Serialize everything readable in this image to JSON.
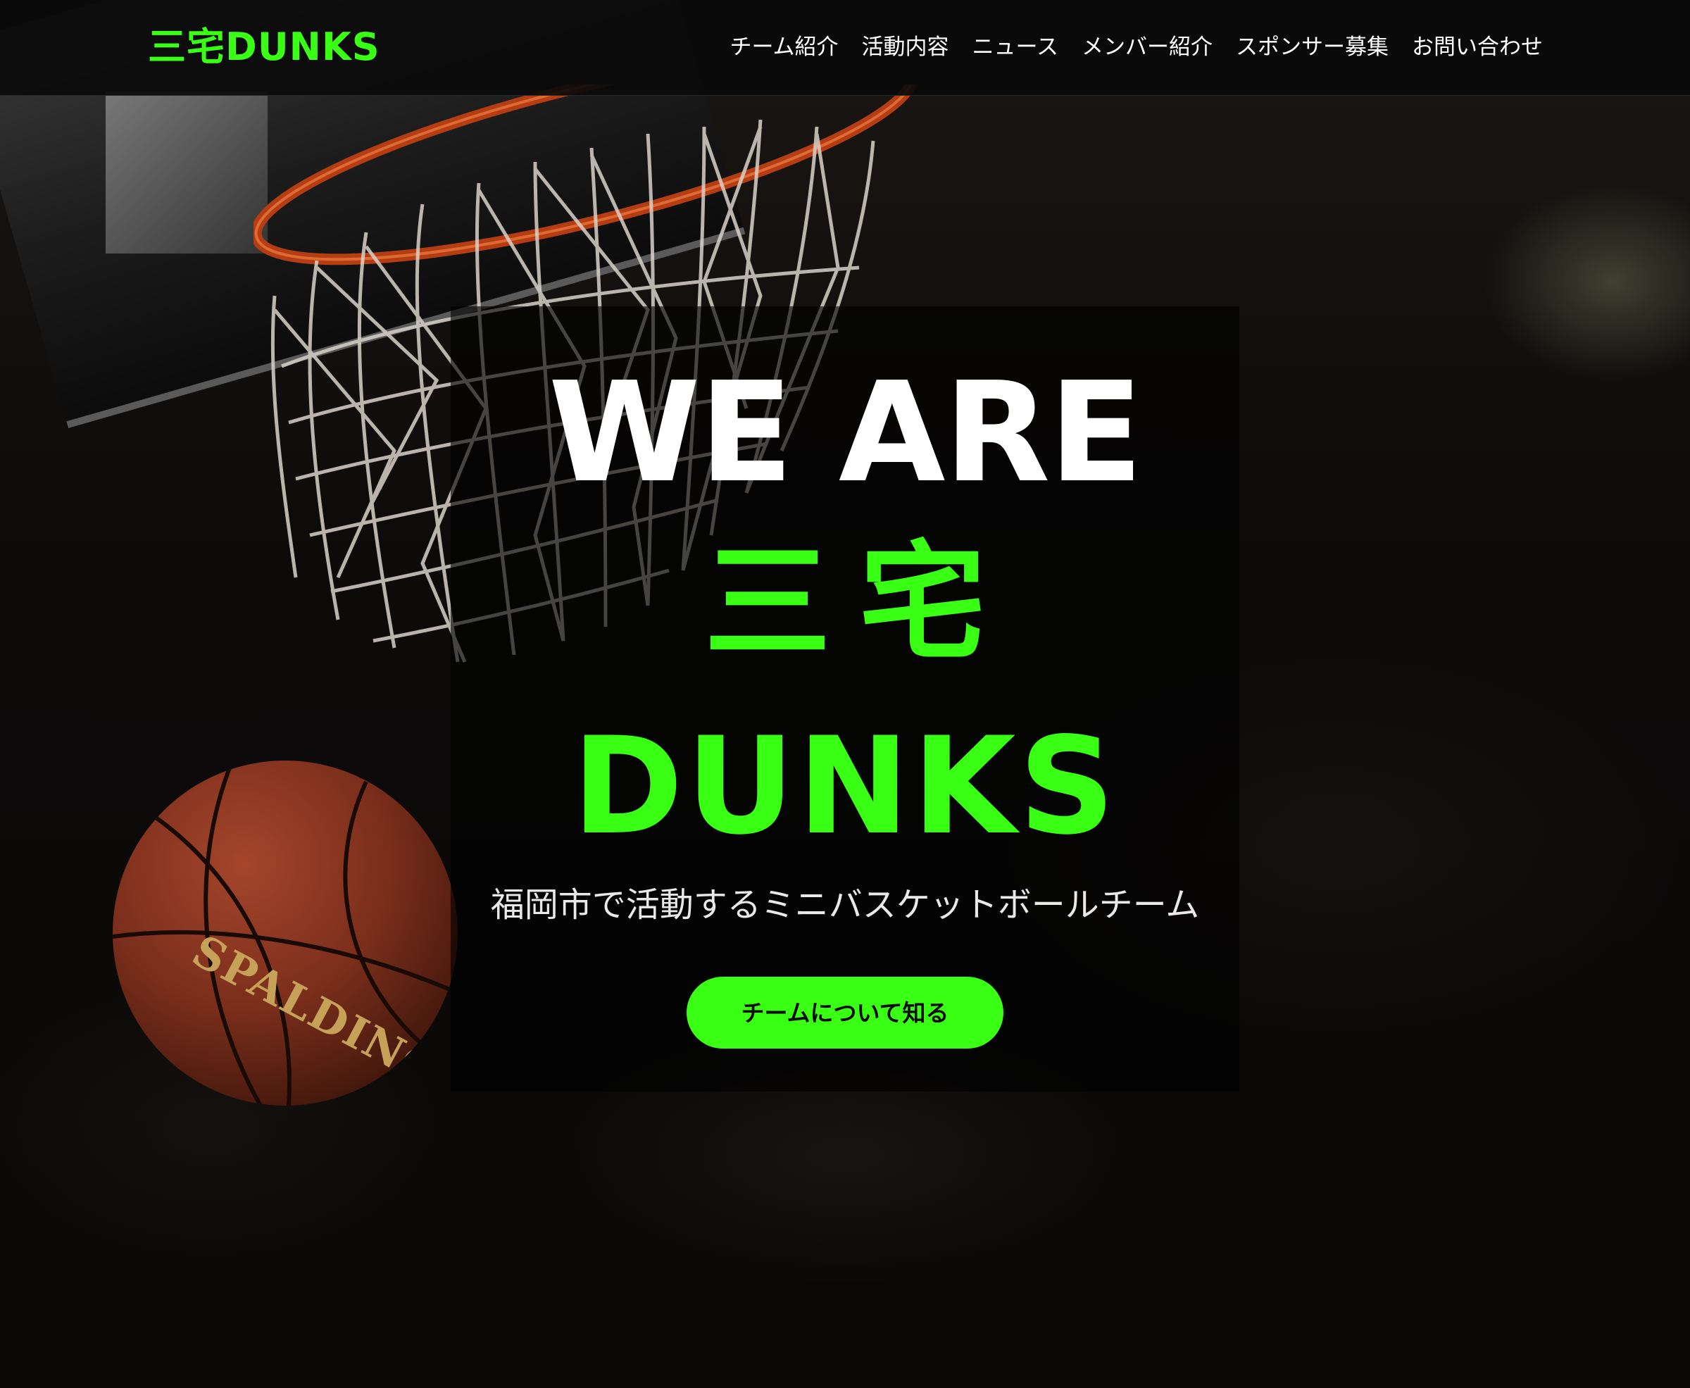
{
  "header": {
    "logo": "三宅DUNKS",
    "nav": [
      "チーム紹介",
      "活動内容",
      "ニュース",
      "メンバー紹介",
      "スポンサー募集",
      "お問い合わせ"
    ]
  },
  "hero": {
    "line1": "WE ARE",
    "line2": "三宅",
    "line3": "DUNKS",
    "subtitle": "福岡市で活動するミニバスケットボールチーム",
    "cta": "チームについて知る"
  },
  "background": {
    "ball_brand": "SPALDING"
  },
  "colors": {
    "accent": "#39ff14",
    "background": "#0a0a0a",
    "text": "#ffffff"
  }
}
